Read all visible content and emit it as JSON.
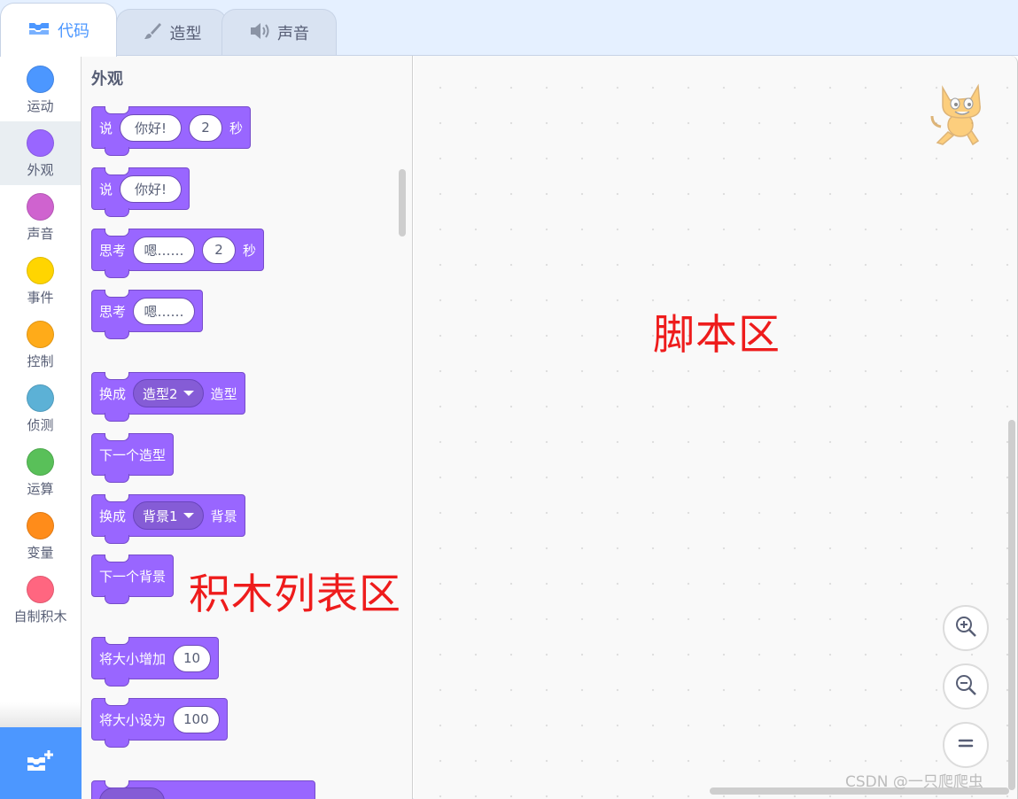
{
  "tabs": [
    {
      "label": "代码",
      "icon": "code-icon",
      "active": true
    },
    {
      "label": "造型",
      "icon": "brush-icon",
      "active": false
    },
    {
      "label": "声音",
      "icon": "speaker-icon",
      "active": false
    }
  ],
  "categories": [
    {
      "label": "运动",
      "color": "#4c97ff"
    },
    {
      "label": "外观",
      "color": "#9966ff"
    },
    {
      "label": "声音",
      "color": "#cf63cf"
    },
    {
      "label": "事件",
      "color": "#ffd500"
    },
    {
      "label": "控制",
      "color": "#ffab19"
    },
    {
      "label": "侦测",
      "color": "#5cb1d6"
    },
    {
      "label": "运算",
      "color": "#59c059"
    },
    {
      "label": "变量",
      "color": "#ff8c1a"
    },
    {
      "label": "自制积木",
      "color": "#ff6680"
    }
  ],
  "selected_category": "外观",
  "palette": {
    "title": "外观",
    "blocks": {
      "say_for": {
        "label": "说",
        "text": "你好!",
        "secs": "2",
        "unit": "秒"
      },
      "say": {
        "label": "说",
        "text": "你好!"
      },
      "think_for": {
        "label": "思考",
        "text": "嗯……",
        "secs": "2",
        "unit": "秒"
      },
      "think": {
        "label": "思考",
        "text": "嗯……"
      },
      "switch_costume": {
        "label": "换成",
        "value": "造型2",
        "suffix": "造型"
      },
      "next_costume": {
        "label": "下一个造型"
      },
      "switch_backdrop": {
        "label": "换成",
        "value": "背景1",
        "suffix": "背景"
      },
      "next_backdrop": {
        "label": "下一个背景"
      },
      "change_size": {
        "label": "将大小增加",
        "value": "10"
      },
      "set_size": {
        "label": "将大小设为",
        "value": "100"
      }
    }
  },
  "annotations": {
    "script_area": "脚本区",
    "block_palette": "积木列表区"
  },
  "watermark": "CSDN @一只爬爬虫",
  "colors": {
    "looks": "#9966ff",
    "accent": "#4c97ff"
  }
}
